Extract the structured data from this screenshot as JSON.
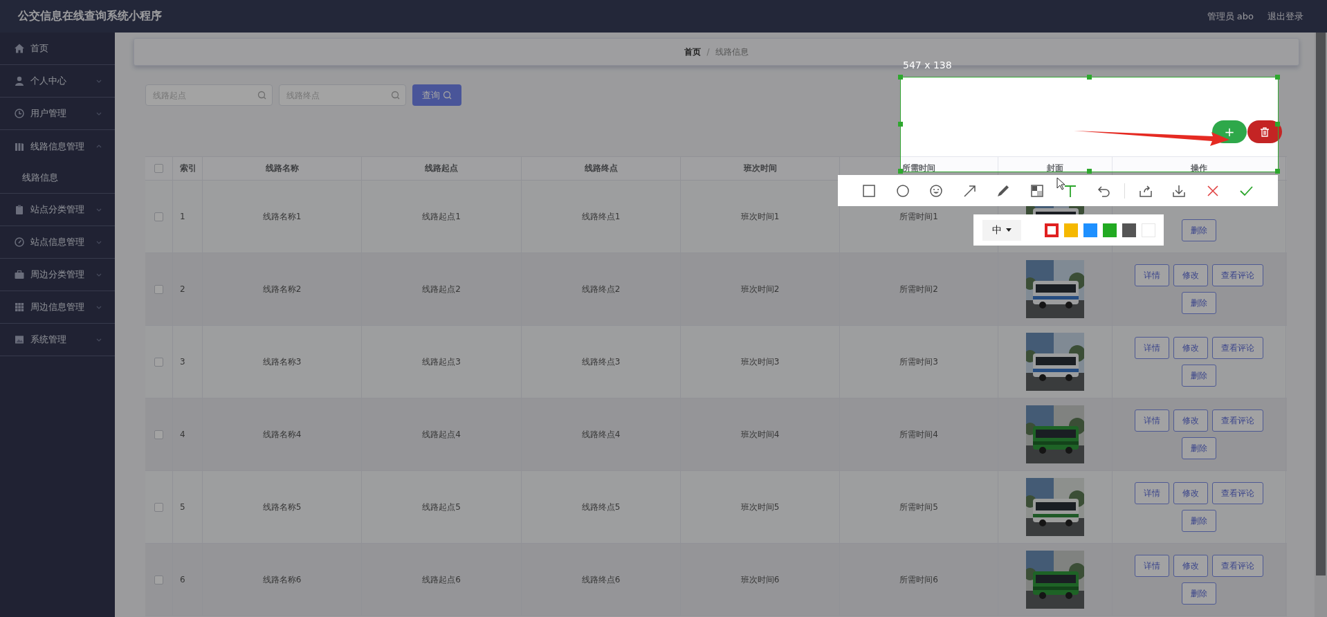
{
  "app": {
    "title": "公交信息在线查询系统小程序",
    "user": "管理员 abo",
    "logout": "退出登录"
  },
  "sidebar": {
    "items": [
      {
        "label": "首页",
        "kind": "link"
      },
      {
        "label": "个人中心",
        "kind": "menu",
        "expanded": false
      },
      {
        "label": "用户管理",
        "kind": "menu",
        "expanded": false
      },
      {
        "label": "线路信息管理",
        "kind": "menu",
        "expanded": true,
        "children": [
          {
            "label": "线路信息"
          }
        ]
      },
      {
        "label": "站点分类管理",
        "kind": "menu",
        "expanded": false
      },
      {
        "label": "站点信息管理",
        "kind": "menu",
        "expanded": false
      },
      {
        "label": "周边分类管理",
        "kind": "menu",
        "expanded": false
      },
      {
        "label": "周边信息管理",
        "kind": "menu",
        "expanded": false
      },
      {
        "label": "系统管理",
        "kind": "menu",
        "expanded": false
      }
    ]
  },
  "breadcrumb": {
    "items": [
      "首页",
      "线路信息"
    ],
    "separator": "/"
  },
  "search": {
    "fields": [
      {
        "placeholder": "线路起点"
      },
      {
        "placeholder": "线路终点"
      }
    ],
    "button": "查询"
  },
  "table": {
    "header_checked": false,
    "columns": [
      "索引",
      "线路名称",
      "线路起点",
      "线路终点",
      "班次时间",
      "所需时间",
      "封面",
      "操作"
    ],
    "rows": [
      {
        "checked": false,
        "cells": [
          "1",
          "线路名称1",
          "线路起点1",
          "线路终点1",
          "班次时间1",
          "所需时间1"
        ],
        "cover": {
          "kind": "picture"
        },
        "actions": [
          {
            "label": "删除",
            "kind": "danger"
          }
        ]
      },
      {
        "checked": false,
        "cells": [
          "2",
          "线路名称2",
          "线路起点2",
          "线路终点2",
          "班次时间2",
          "所需时间2"
        ],
        "cover": {
          "kind": "picture"
        },
        "actions": [
          {
            "label": "详情",
            "kind": "normal"
          },
          {
            "label": "修改",
            "kind": "normal"
          },
          {
            "label": "查看评论",
            "kind": "normal"
          },
          {
            "label": "删除",
            "kind": "danger"
          }
        ]
      },
      {
        "checked": false,
        "cells": [
          "3",
          "线路名称3",
          "线路起点3",
          "线路终点3",
          "班次时间3",
          "所需时间3"
        ],
        "cover": {
          "kind": "picture"
        },
        "actions": [
          {
            "label": "详情",
            "kind": "normal"
          },
          {
            "label": "修改",
            "kind": "normal"
          },
          {
            "label": "查看评论",
            "kind": "normal"
          },
          {
            "label": "删除",
            "kind": "danger"
          }
        ]
      },
      {
        "checked": false,
        "cells": [
          "4",
          "线路名称4",
          "线路起点4",
          "线路终点4",
          "班次时间4",
          "所需时间4"
        ],
        "cover": {
          "kind": "picture"
        },
        "actions": [
          {
            "label": "详情",
            "kind": "normal"
          },
          {
            "label": "修改",
            "kind": "normal"
          },
          {
            "label": "查看评论",
            "kind": "normal"
          },
          {
            "label": "删除",
            "kind": "danger"
          }
        ]
      },
      {
        "checked": false,
        "cells": [
          "5",
          "线路名称5",
          "线路起点5",
          "线路终点5",
          "班次时间5",
          "所需时间5"
        ],
        "cover": {
          "kind": "picture"
        },
        "actions": [
          {
            "label": "详情",
            "kind": "normal"
          },
          {
            "label": "修改",
            "kind": "normal"
          },
          {
            "label": "查看评论",
            "kind": "normal"
          },
          {
            "label": "删除",
            "kind": "danger"
          }
        ]
      },
      {
        "checked": false,
        "cells": [
          "6",
          "线路名称6",
          "线路起点6",
          "线路终点6",
          "班次时间6",
          "所需时间6"
        ],
        "cover": {
          "kind": "picture"
        },
        "actions": [
          {
            "label": "详情",
            "kind": "normal"
          },
          {
            "label": "修改",
            "kind": "normal"
          },
          {
            "label": "查看评论",
            "kind": "normal"
          },
          {
            "label": "删除",
            "kind": "danger"
          }
        ]
      }
    ]
  },
  "capture": {
    "size_label": "547 x 138",
    "add_button": "+",
    "tools": [
      {
        "kind": "rectangle",
        "selected": false
      },
      {
        "kind": "ellipse",
        "selected": false
      },
      {
        "kind": "emoji",
        "selected": false
      },
      {
        "kind": "arrow",
        "selected": false
      },
      {
        "kind": "pen",
        "selected": false
      },
      {
        "kind": "mosaic",
        "selected": false
      },
      {
        "kind": "text",
        "selected": true
      }
    ],
    "actions": [
      {
        "kind": "undo"
      },
      {
        "kind": "share"
      },
      {
        "kind": "download"
      },
      {
        "kind": "cancel"
      },
      {
        "kind": "confirm"
      }
    ],
    "palette": {
      "size": "中",
      "colors": [
        {
          "color": "#e02020",
          "selected": true
        },
        {
          "color": "#f5b800",
          "selected": false
        },
        {
          "color": "#1e90ff",
          "selected": false
        },
        {
          "color": "#22aa22",
          "selected": false
        },
        {
          "color": "#555555",
          "selected": false
        },
        {
          "color": "#ffffff",
          "selected": false
        }
      ]
    }
  }
}
